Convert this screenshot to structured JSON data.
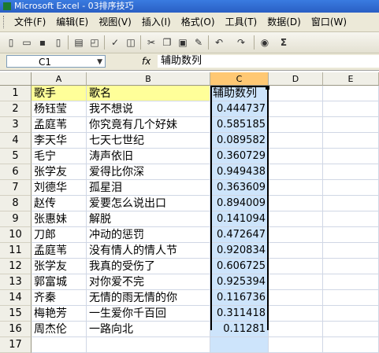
{
  "window": {
    "title": "Microsoft Excel - 03排序技巧"
  },
  "menu": [
    "文件(F)",
    "编辑(E)",
    "视图(V)",
    "插入(I)",
    "格式(O)",
    "工具(T)",
    "数据(D)",
    "窗口(W)"
  ],
  "toolbar": {
    "icons": [
      "new-icon",
      "open-icon",
      "save-icon",
      "permission-icon",
      "print-icon",
      "print-preview-icon",
      "spelling-icon",
      "research-icon",
      "cut-icon",
      "copy-icon",
      "paste-icon",
      "format-painter-icon",
      "undo-icon",
      "redo-icon",
      "hyperlink-icon",
      "autosum-icon"
    ],
    "autosum_glyph": "Σ"
  },
  "formula_bar": {
    "name_box": "C1",
    "fx": "fx",
    "content": "辅助数列"
  },
  "columns": [
    "A",
    "B",
    "C",
    "D",
    "E"
  ],
  "rows": [
    {
      "n": "1",
      "a": "歌手",
      "b": "歌名",
      "c": "辅助数列"
    },
    {
      "n": "2",
      "a": "杨钰莹",
      "b": "我不想说",
      "c": "0.444737"
    },
    {
      "n": "3",
      "a": "孟庭苇",
      "b": "你究竟有几个好妹",
      "c": "0.585185"
    },
    {
      "n": "4",
      "a": "李天华",
      "b": "七天七世纪",
      "c": "0.089582"
    },
    {
      "n": "5",
      "a": "毛宁",
      "b": "涛声依旧",
      "c": "0.360729"
    },
    {
      "n": "6",
      "a": "张学友",
      "b": "爱得比你深",
      "c": "0.949438"
    },
    {
      "n": "7",
      "a": "刘德华",
      "b": "孤星泪",
      "c": "0.363609"
    },
    {
      "n": "8",
      "a": "赵传",
      "b": "爱要怎么说出口",
      "c": "0.894009"
    },
    {
      "n": "9",
      "a": "张惠妹",
      "b": "解脱",
      "c": "0.141094"
    },
    {
      "n": "10",
      "a": "刀郎",
      "b": "冲动的惩罚",
      "c": "0.472647"
    },
    {
      "n": "11",
      "a": "孟庭苇",
      "b": "没有情人的情人节",
      "c": "0.920834"
    },
    {
      "n": "12",
      "a": "张学友",
      "b": "我真的受伤了",
      "c": "0.606725"
    },
    {
      "n": "13",
      "a": "郭富城",
      "b": "对你爱不完",
      "c": "0.925394"
    },
    {
      "n": "14",
      "a": "齐秦",
      "b": "无情的雨无情的你",
      "c": "0.116736"
    },
    {
      "n": "15",
      "a": "梅艳芳",
      "b": "一生爱你千百回",
      "c": "0.311418"
    },
    {
      "n": "16",
      "a": "周杰伦",
      "b": "一路向北",
      "c": "0.11281"
    },
    {
      "n": "17",
      "a": "",
      "b": "",
      "c": ""
    }
  ]
}
